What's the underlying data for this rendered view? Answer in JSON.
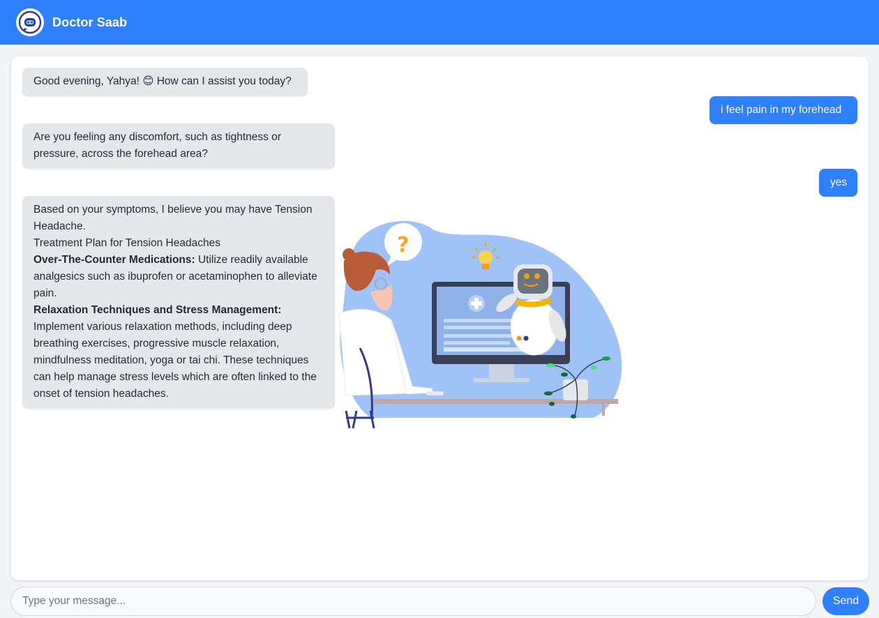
{
  "app": {
    "title": "Doctor Saab"
  },
  "icons": {
    "logo": "robot-chat-icon"
  },
  "colors": {
    "brand": "#2f80ff",
    "bot_bubble": "#e5e7eb",
    "user_bubble": "#2f80ff"
  },
  "messages": [
    {
      "sender": "bot",
      "text": "Good evening, Yahya! 😊 How can I assist you today?"
    },
    {
      "sender": "user",
      "text": "i feel pain in my forehead"
    },
    {
      "sender": "bot",
      "text": "Are you feeling any discomfort, such as tightness or pressure, across the forehead area?"
    },
    {
      "sender": "user",
      "text": "yes"
    },
    {
      "sender": "bot",
      "intro": "Based on your symptoms, I believe you may have Tension Headache.",
      "plan_title": "Treatment Plan for Tension Headaches",
      "section1_title": "Over-The-Counter Medications:",
      "section1_text": " Utilize readily available analgesics such as ibuprofen or acetaminophen to alleviate pain.",
      "section2_title": "Relaxation Techniques and Stress Management:",
      "section2_text": "Implement various relaxation methods, including deep breathing exercises, progressive muscle relaxation, mindfulness meditation, yoga or tai chi. These techniques can help manage stress levels which are often linked to the onset of tension headaches."
    }
  ],
  "composer": {
    "placeholder": "Type your message...",
    "value": "",
    "send_label": "Send"
  }
}
